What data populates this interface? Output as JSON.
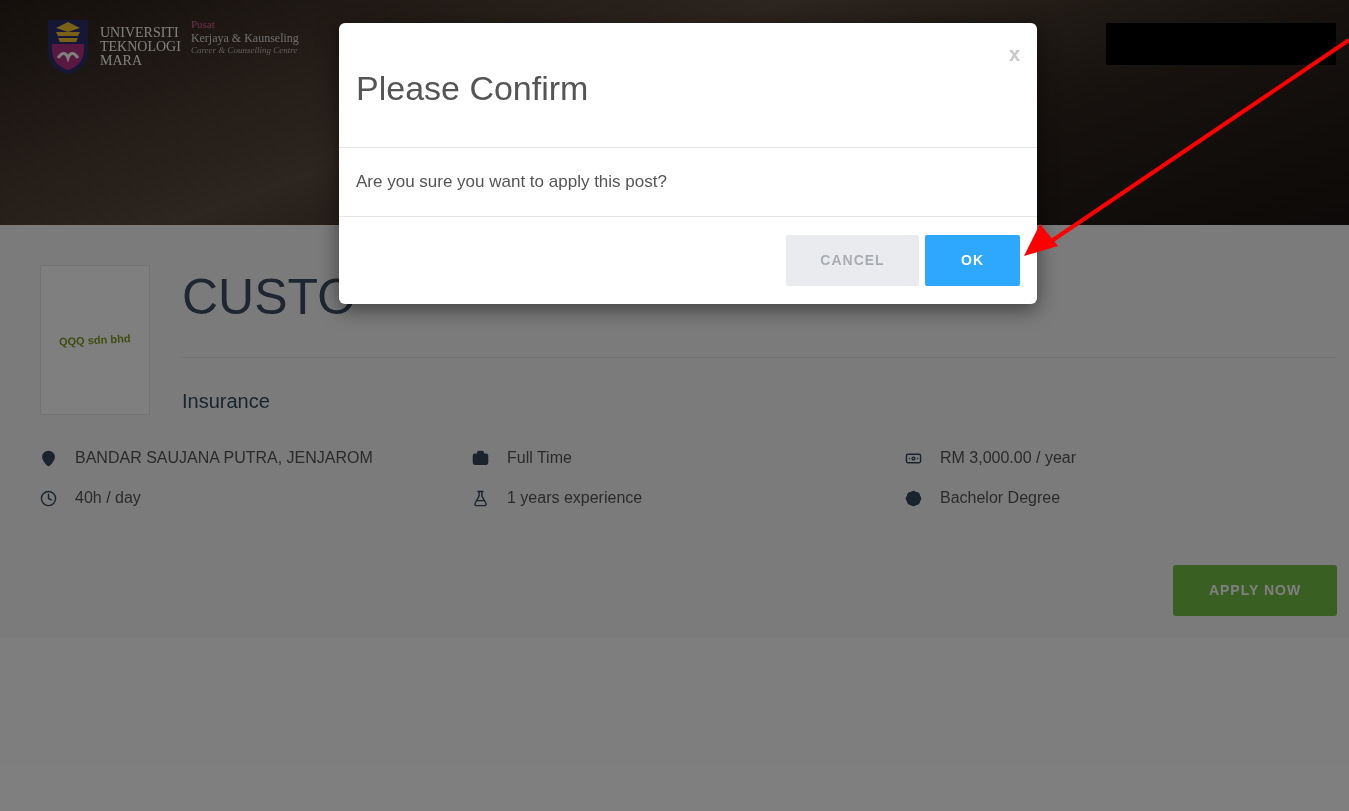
{
  "header": {
    "university": [
      "UNIVERSITI",
      "TEKNOLOGI",
      "MARA"
    ],
    "centre": {
      "prefix": "Pusat",
      "name": "Kerjaya & Kaunseling",
      "subtitle": "Career & Counselling Centre"
    }
  },
  "job": {
    "company_logo_text": "QQQ sdn bhd",
    "title": "CUSTO",
    "category": "Insurance",
    "details": [
      {
        "kind": "location",
        "text": "BANDAR SAUJANA PUTRA, JENJAROM"
      },
      {
        "kind": "type",
        "text": "Full Time"
      },
      {
        "kind": "salary",
        "text": "RM 3,000.00 / year"
      },
      {
        "kind": "hours",
        "text": "40h / day"
      },
      {
        "kind": "experience",
        "text": "1 years experience"
      },
      {
        "kind": "education",
        "text": "Bachelor Degree"
      }
    ],
    "apply_button": "APPLY NOW"
  },
  "dialog": {
    "title": "Please Confirm",
    "close": "x",
    "message": "Are you sure you want to apply this post?",
    "buttons": [
      {
        "label": "CANCEL",
        "kind": "secondary"
      },
      {
        "label": "OK",
        "kind": "primary"
      }
    ]
  }
}
